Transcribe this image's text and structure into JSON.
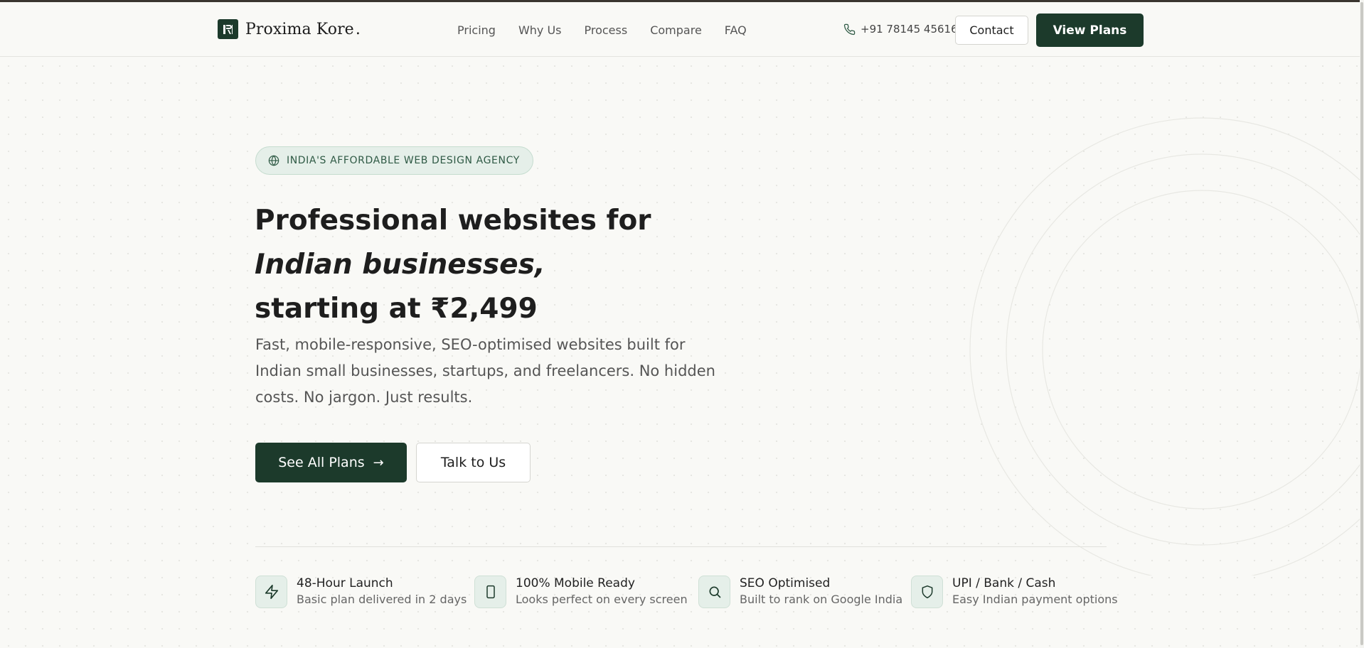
{
  "brand": {
    "name": "Proxima Kore",
    "dot": "."
  },
  "nav": {
    "items": [
      "Pricing",
      "Why Us",
      "Process",
      "Compare",
      "FAQ"
    ]
  },
  "header": {
    "phone": "+91 78145 45616",
    "contact_label": "Contact",
    "view_plans_label": "View Plans"
  },
  "hero": {
    "badge": "INDIA'S AFFORDABLE WEB DESIGN AGENCY",
    "headline_line1": "Professional websites for",
    "headline_line2": "Indian businesses,",
    "headline_line3": "starting at ₹2,499",
    "subtext": "Fast, mobile-responsive, SEO-optimised websites built for Indian small businesses, startups, and freelancers. No hidden costs. No jargon. Just results.",
    "primary_cta": "See All Plans",
    "secondary_cta": "Talk to Us"
  },
  "features": [
    {
      "icon": "lightning-icon",
      "title": "48-Hour Launch",
      "desc": "Basic plan delivered in 2 days"
    },
    {
      "icon": "mobile-icon",
      "title": "100% Mobile Ready",
      "desc": "Looks perfect on every screen"
    },
    {
      "icon": "search-icon",
      "title": "SEO Optimised",
      "desc": "Built to rank on Google India"
    },
    {
      "icon": "shield-icon",
      "title": "UPI / Bank / Cash",
      "desc": "Easy Indian payment options"
    }
  ],
  "colors": {
    "accent": "#1c3a2b",
    "badge_bg": "#e5efe9",
    "background": "#f9f9f6"
  }
}
